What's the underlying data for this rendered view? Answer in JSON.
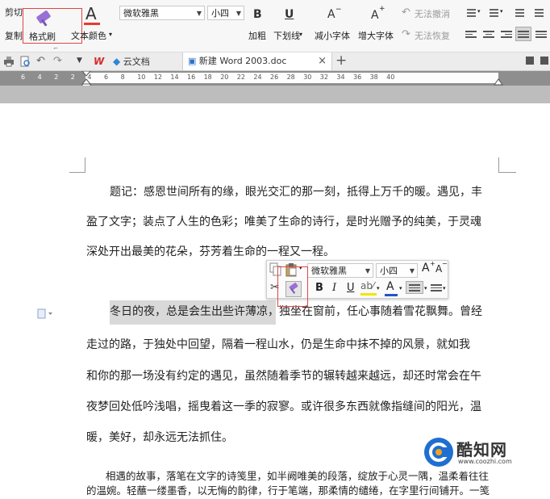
{
  "ribbon": {
    "cut": "剪切",
    "copy": "复制",
    "format_painter": "格式刷",
    "text_color": "文本颜色",
    "font_name": "微软雅黑",
    "font_size": "小四",
    "bold": "加粗",
    "underline": "下划线",
    "shrink_font": "减小字体",
    "grow_font": "增大字体",
    "undo": "无法撤消",
    "redo": "无法恢复",
    "bold_glyph": "B",
    "underline_glyph": "U",
    "text_color_glyph": "A",
    "grow_glyph": "A",
    "shrink_glyph": "A"
  },
  "tabs": [
    {
      "label": "",
      "icon": "wps-logo-icon"
    },
    {
      "label": "云文档",
      "icon": "cloud-docs-icon"
    },
    {
      "label": "新建 Word 2003.doc",
      "icon": "document-icon",
      "active": true
    }
  ],
  "tab_close": "×",
  "tab_add": "+",
  "ruler_ticks": [
    "6",
    "4",
    "2",
    "2",
    "4",
    "6",
    "8",
    "10",
    "12",
    "14",
    "16",
    "18",
    "20",
    "22",
    "24",
    "26",
    "28",
    "30",
    "32",
    "34",
    "36",
    "38",
    "40",
    "42",
    "44"
  ],
  "document": {
    "paragraph1": [
      "题记：感恩世间所有的缘，眼光交汇的那一刻，抵得上万千的暖。遇见，丰",
      "盈了文字；装点了人生的色彩；唯美了生命的诗行，是时光赠予的纯美，于灵魂",
      "深处开出最美的花朵，芬芳着生命的一程又一程。"
    ],
    "paragraph2_selected": "冬日的夜，总是会生出些许薄凉",
    "paragraph2": [
      "，独坐在窗前，任心事随着雪花飘舞。曾经",
      "走过的路，于独处中回望，隔着一程山水，仍是生命中抹不掉的风景，就如我",
      "和你的那一场没有约定的遇见，虽然随着季节的辗转越来越远，却还时常会在午",
      "夜梦回处低吟浅唱，摇曳着这一季的寂寥。或许很多东西就像指缝间的阳光，温",
      "暖，美好，却永远无法抓住。"
    ],
    "paragraph3": [
      "相遇的故事，落笔在文字的诗笺里，如半阙唯美的段落，绽放于心灵一隅，温柔着往往",
      "的温婉。轻蘸一缕墨香，以无悔的韵律，行于笔端，那柔情的缱绻，在字里行间铺开。一笺"
    ]
  },
  "mini_toolbar": {
    "font_name": "微软雅黑",
    "font_size": "小四",
    "bold": "B",
    "italic": "I",
    "underline": "U",
    "font_color": "A",
    "grow": "A",
    "shrink": "A"
  },
  "watermark": {
    "text": "酷知网",
    "url": "www.coozhi.com"
  }
}
